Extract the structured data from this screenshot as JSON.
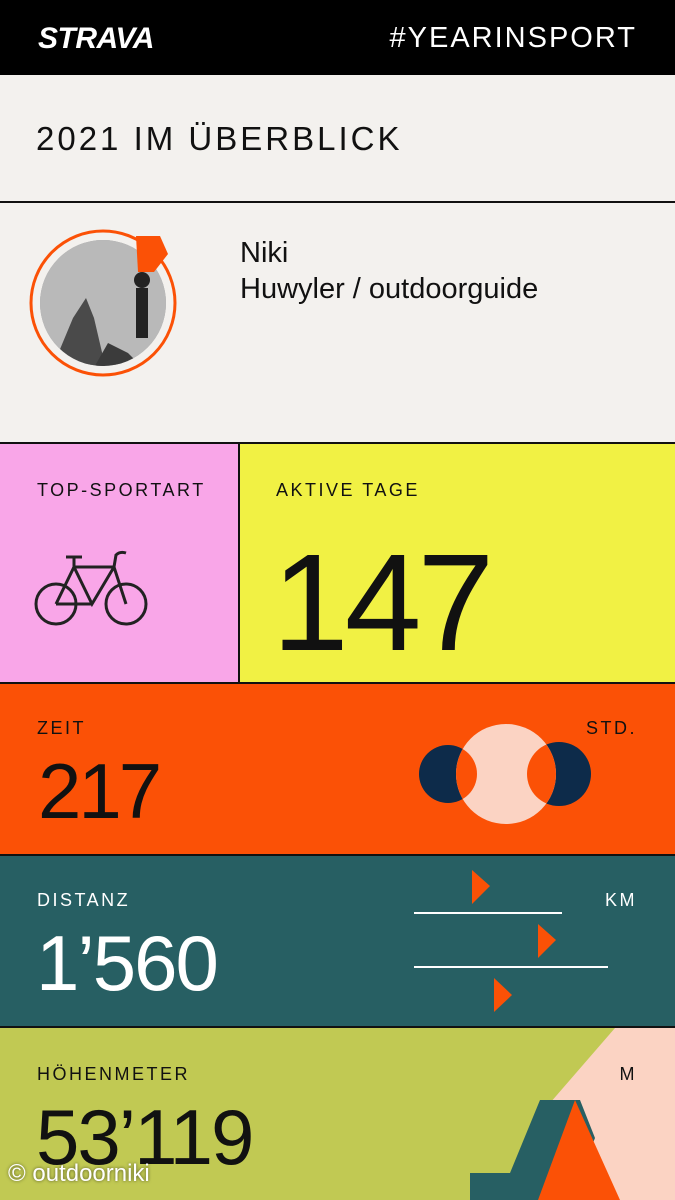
{
  "header": {
    "logo": "STRAVA",
    "hashtag": "#YEARINSPORT"
  },
  "overview": {
    "title": "2021 IM ÜBERBLICK"
  },
  "profile": {
    "name_line1": "Niki",
    "name_line2": "Huwyler / outdoorguide"
  },
  "top_sport": {
    "label": "TOP-SPORTART",
    "icon": "bicycle-icon"
  },
  "active_days": {
    "label": "AKTIVE TAGE",
    "value": "147"
  },
  "time": {
    "label": "ZEIT",
    "value": "217",
    "unit": "STD."
  },
  "distance": {
    "label": "DISTANZ",
    "value": "1’560",
    "unit": "KM"
  },
  "elevation": {
    "label": "HÖHENMETER",
    "value": "53’119",
    "unit": "M"
  },
  "credit": "© outdoorniki",
  "colors": {
    "pink": "#f9a6e8",
    "yellow": "#f1f144",
    "orange": "#fb5106",
    "teal": "#275f63",
    "green": "#c1c953",
    "navy": "#0d2b4a",
    "peach": "#fbd3c3"
  }
}
